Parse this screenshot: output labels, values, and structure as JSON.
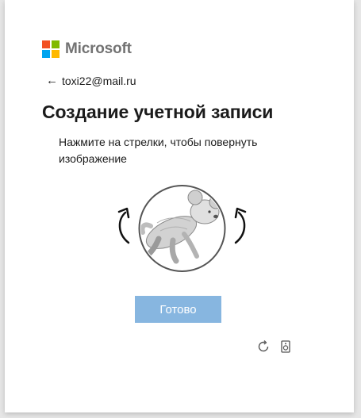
{
  "brand": {
    "name": "Microsoft",
    "logo_colors": [
      "#f25022",
      "#7fba00",
      "#00a4ef",
      "#ffb900"
    ]
  },
  "account": {
    "email": "toxi22@mail.ru"
  },
  "page": {
    "title": "Создание учетной записи",
    "instruction": "Нажмите на стрелки, чтобы повернуть изображение"
  },
  "puzzle": {
    "rotate_left_icon": "rotate-counterclockwise-arrow",
    "rotate_right_icon": "rotate-clockwise-arrow",
    "image_subject": "koala"
  },
  "actions": {
    "done_label": "Готово"
  },
  "tools": {
    "refresh_icon": "refresh",
    "audio_icon": "audio-speaker"
  },
  "colors": {
    "button": "#87b6e0",
    "text": "#1b1b1b",
    "page_bg": "#e6e6e6"
  }
}
